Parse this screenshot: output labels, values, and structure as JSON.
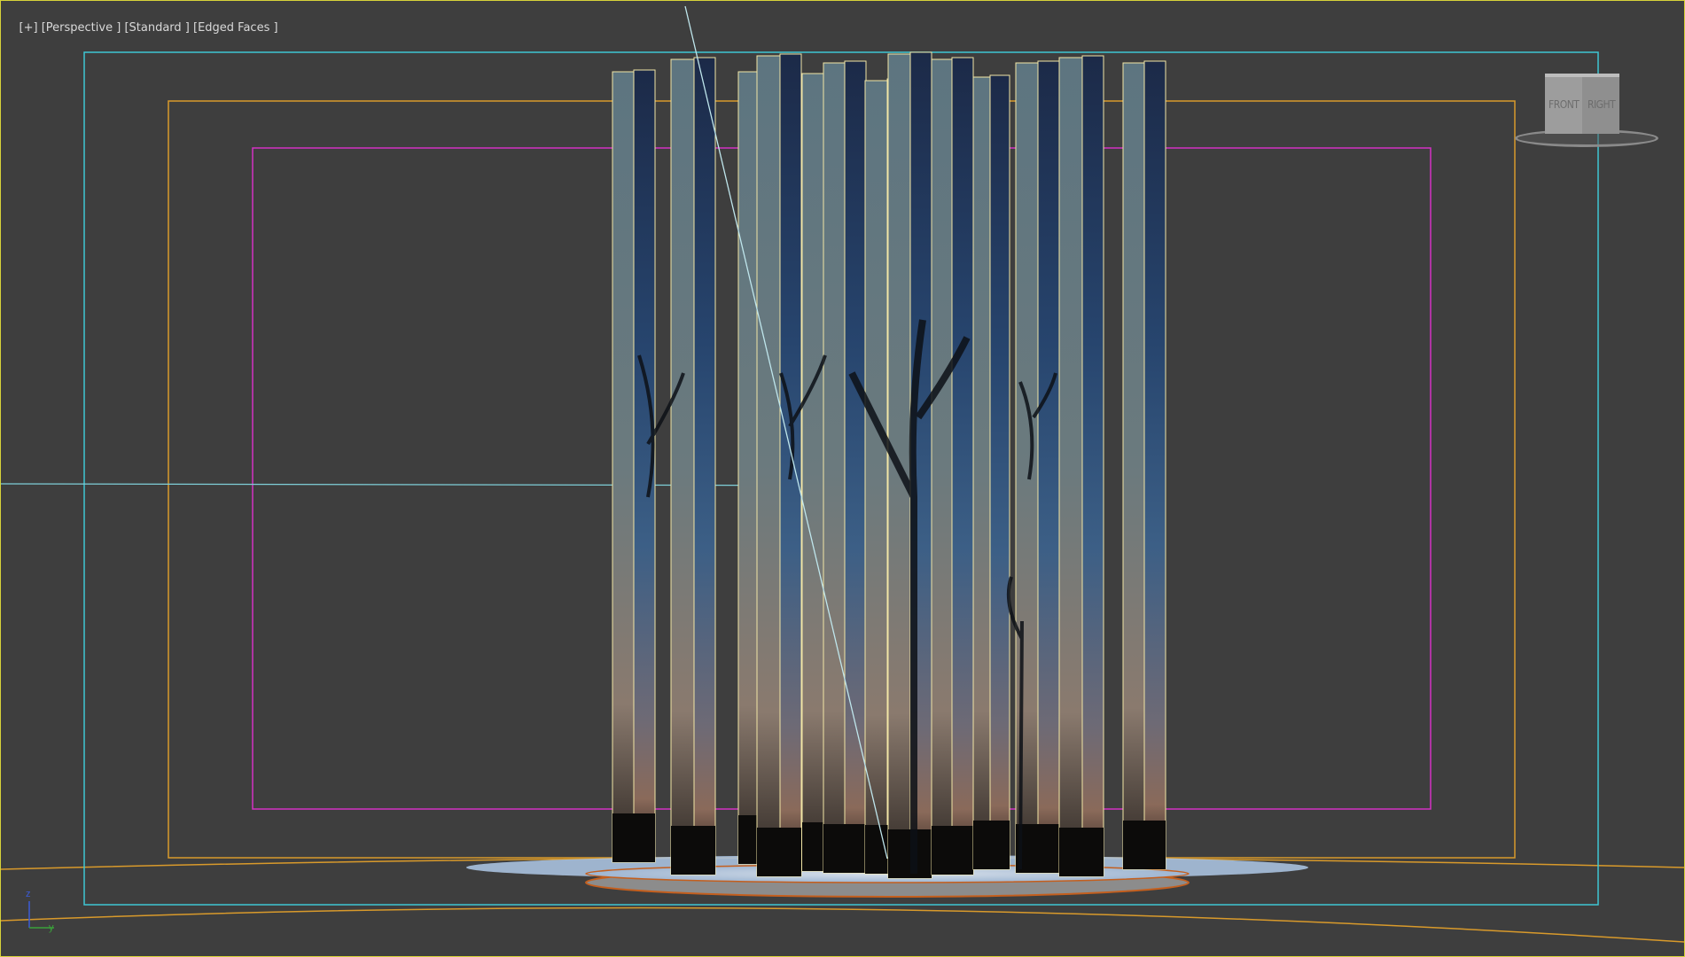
{
  "viewport": {
    "label_plus": "[+]",
    "label_view": "[Perspective ]",
    "label_shading": "[Standard ]",
    "label_faces": "[Edged Faces ]"
  },
  "view_cube": {
    "front_label": "FRONT",
    "right_label": "RIGHT"
  },
  "axis_gizmo": {
    "z_label": "z",
    "y_label": "y"
  },
  "colors": {
    "viewport_bg": "#3e3e3e",
    "viewport_border": "#d7d33a",
    "safe_frame_outer": "#3fc6d4",
    "safe_frame_action": "#d99a2b",
    "safe_frame_title": "#d431c4",
    "ground_grid": "#d99a2b",
    "panel_edge": "#f2e6a6"
  }
}
